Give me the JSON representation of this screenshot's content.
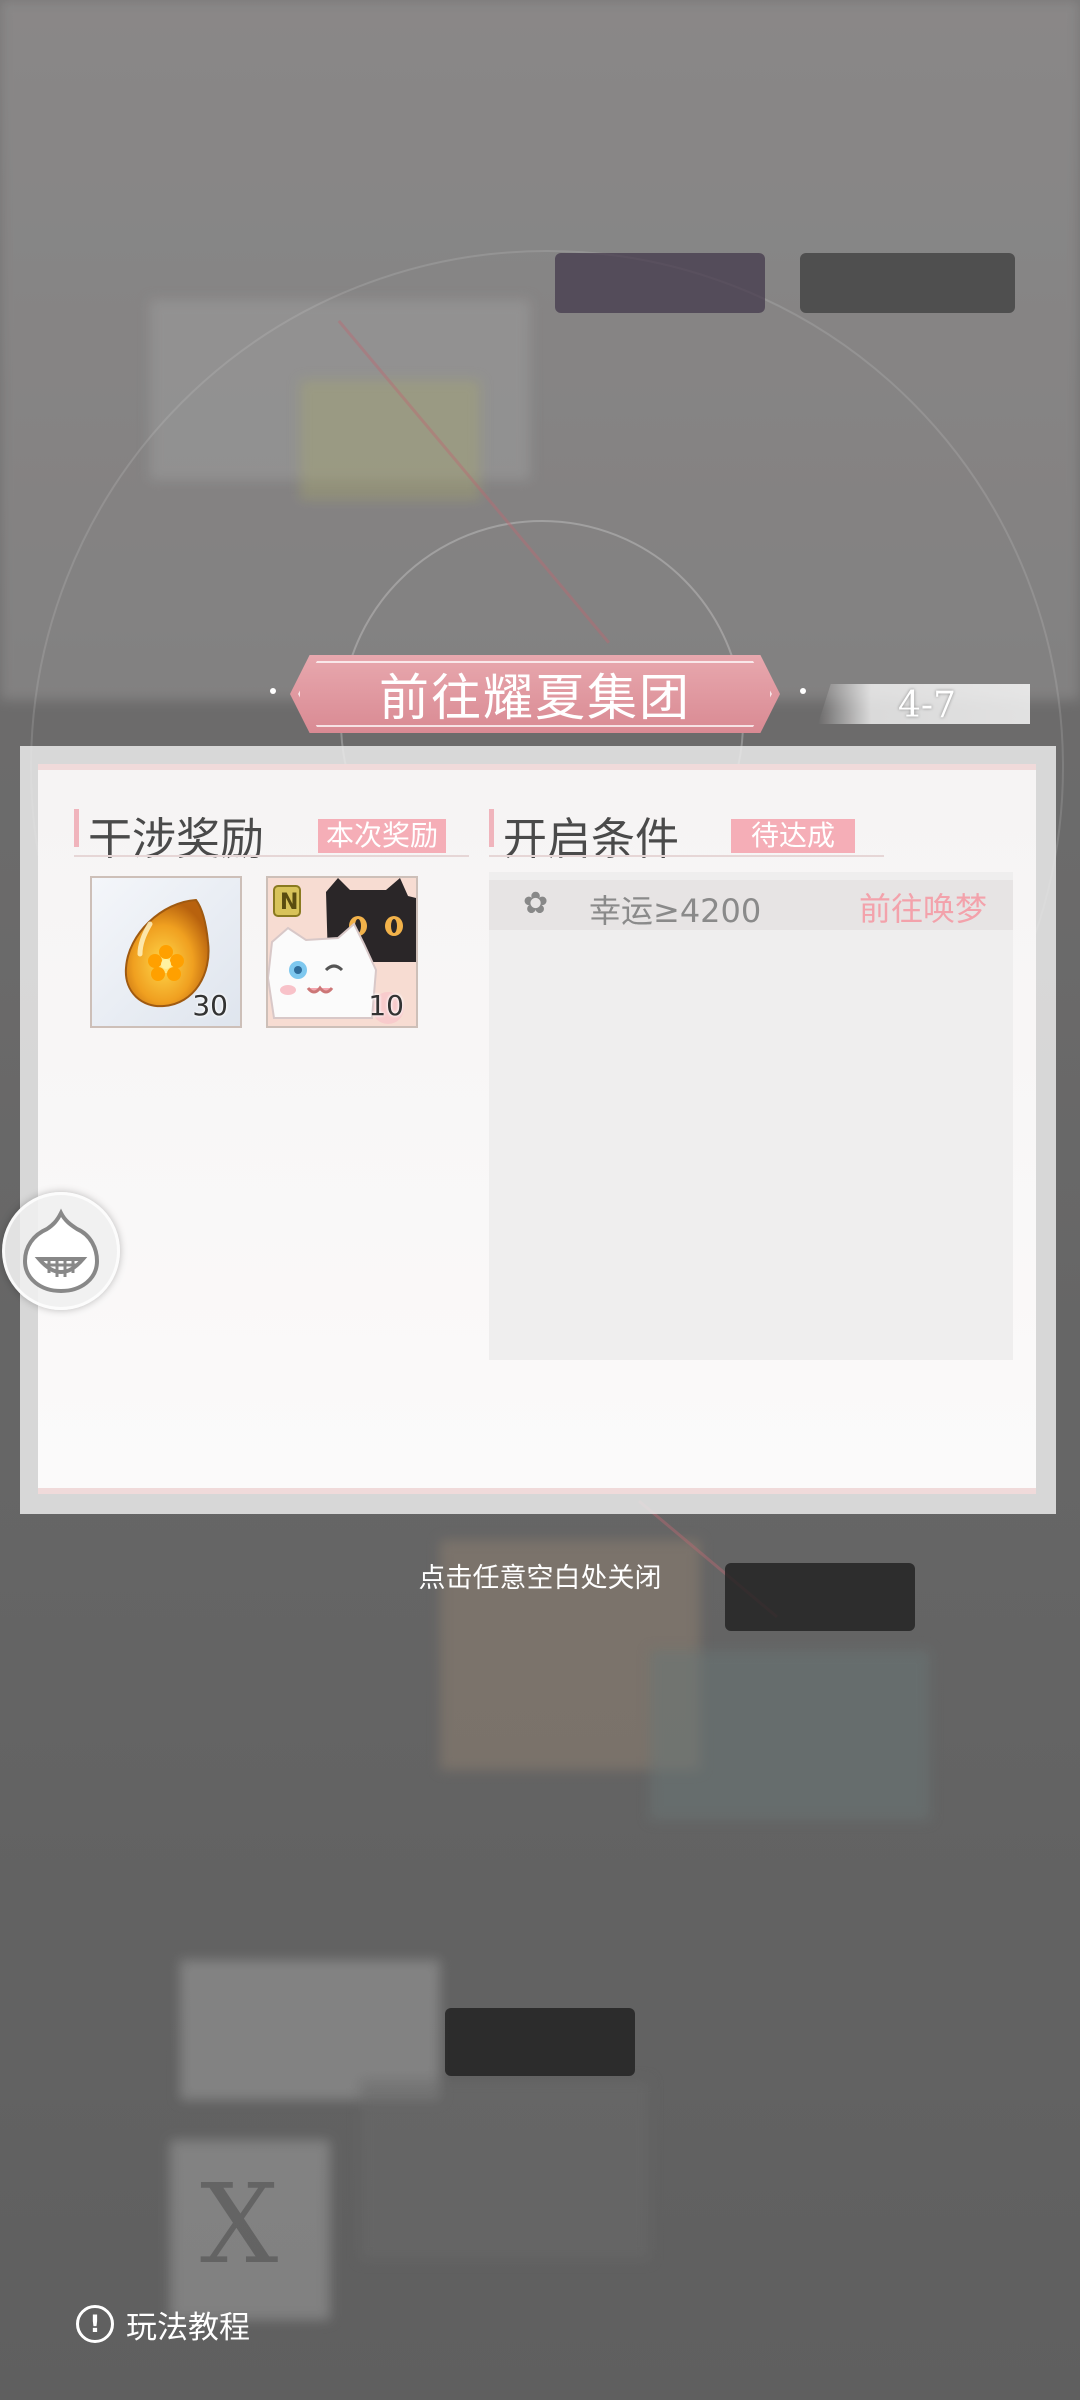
{
  "dialog": {
    "title": "前往耀夏集团",
    "stage": "4-7",
    "rewards": {
      "title": "干涉奖励",
      "badge": "本次奖励",
      "items": [
        {
          "name": "amber-gem-icon",
          "count": "30"
        },
        {
          "name": "cat-card-icon",
          "count": "10"
        }
      ]
    },
    "conditions": {
      "title": "开启条件",
      "badge": "待达成",
      "rows": [
        {
          "icon": "clover-icon",
          "text": "幸运≥4200",
          "action": "前往唤梦"
        }
      ]
    }
  },
  "close_hint": "点击任意空白处关闭",
  "tutorial_label": "玩法教程",
  "colors": {
    "accent_pink": "#f5aeb7",
    "banner": "#d98a93"
  }
}
